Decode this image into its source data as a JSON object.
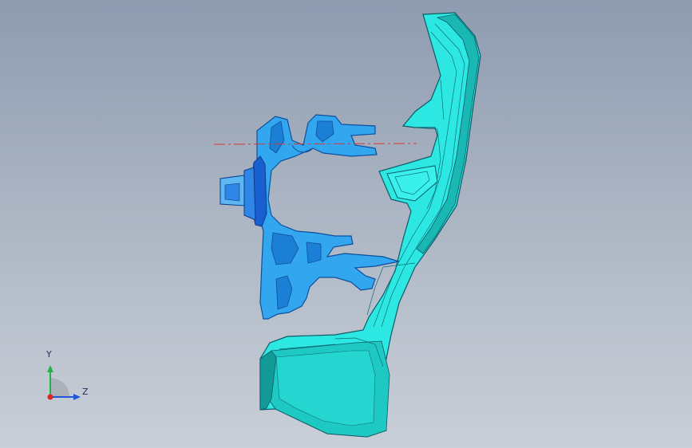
{
  "viewport": {
    "background_top": "#8e9bb0",
    "background_bottom": "#c9cfd8"
  },
  "model": {
    "body_color": "#2de8e2",
    "body_shade": "#17b9b3",
    "body_edge": "#0c5a66",
    "profile_color": "#33a6f0",
    "profile_dark": "#1670c8",
    "fastener_color": "#2f86e6",
    "centerline_color": "#d23a3a"
  },
  "triad": {
    "y_label": "Y",
    "z_label": "Z",
    "y_color": "#22b24a",
    "z_color": "#2356d8",
    "x_color": "#e02424"
  }
}
